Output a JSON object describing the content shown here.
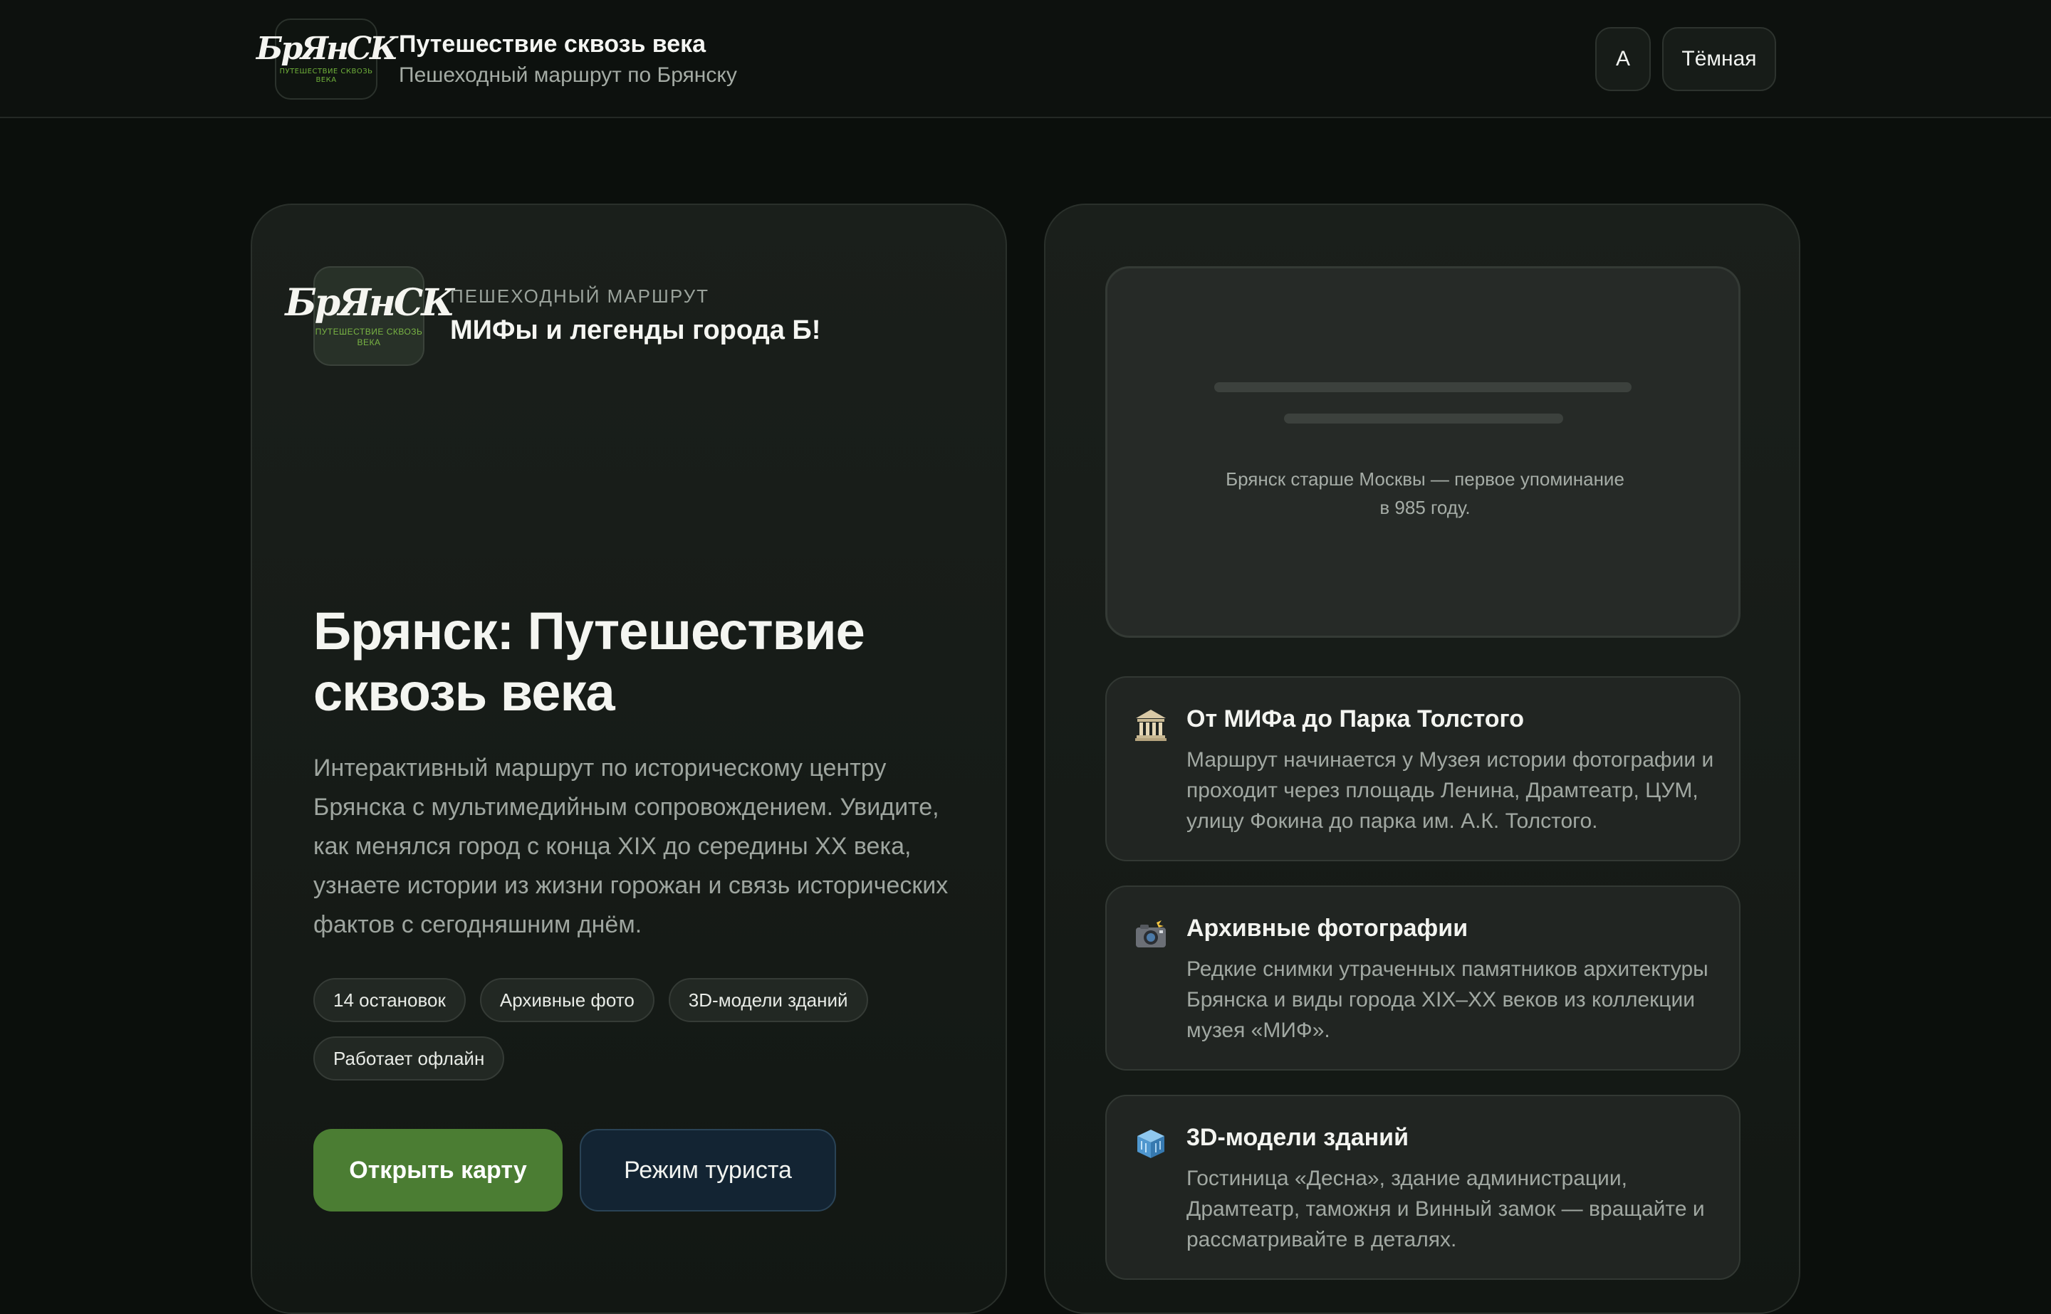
{
  "header": {
    "logo_mark": "БрЯнСК",
    "logo_sub": "путешествие сквозь века",
    "title": "Путешествие сквозь века",
    "subtitle": "Пешеходный маршрут по Брянску",
    "font_button": "A",
    "theme_button": "Тёмная"
  },
  "route": {
    "logo_mark": "БрЯнСК",
    "logo_sub": "путешествие сквозь века",
    "kicker": "ПЕШЕХОДНЫЙ МАРШРУТ",
    "name": "МИФы и легенды города Б!"
  },
  "hero": {
    "title": "Брянск: Путешествие сквозь века",
    "description": "Интерактивный маршрут по историческому центру Брянска с мультимедийным сопровождением. Увидите, как менялся город с конца XIX до середины XX века, узнаете истории из жизни горожан и связь исторических фактов с сегодняшним днём.",
    "chips": [
      "14 остановок",
      "Архивные фото",
      "3D-модели зданий",
      "Работает офлайн"
    ],
    "primary_button": "Открыть карту",
    "secondary_button": "Режим туриста"
  },
  "fact": {
    "text": "Брянск старше Москвы — первое упоминание в 985 году."
  },
  "features": [
    {
      "icon": "museum-icon",
      "title": "От МИФа до Парка Толстого",
      "description": "Маршрут начинается у Музея истории фотографии и проходит через площадь Ленина, Драмтеатр, ЦУМ, улицу Фокина до парка им. А.К. Толстого."
    },
    {
      "icon": "camera-flash-icon",
      "title": "Архивные фотографии",
      "description": "Редкие снимки утраченных памятников архитектуры Брянска и виды города XIX–XX веков из коллекции музея «МИФ»."
    },
    {
      "icon": "cube-icon",
      "title": "3D-модели зданий",
      "description": "Гостиница «Десна», здание администрации, Драмтеатр, таможня и Винный замок — вращайте и рассматривайте в деталях."
    }
  ],
  "colors": {
    "background": "#0b0f0c",
    "accent_green": "#4b7d33",
    "accent_navy": "#132433",
    "logo_green": "#6fb03a"
  }
}
